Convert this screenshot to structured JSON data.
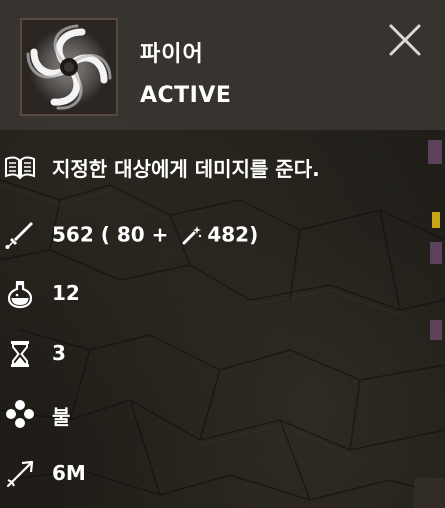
{
  "skill": {
    "name": "파이어",
    "type": "ACTIVE"
  },
  "stats": {
    "description": "지정한 대상에게 데미지를 준다.",
    "damage_total": "562",
    "damage_open": " ( 80 + ",
    "damage_magic": "482)",
    "mana_cost": "12",
    "cooldown": "3",
    "element": "불",
    "range": "6M"
  },
  "icons": {
    "close": "close-icon",
    "description": "book-icon",
    "damage": "sword-icon",
    "magic_power": "wand-icon",
    "mana": "potion-icon",
    "cooldown": "hourglass-icon",
    "element": "element-icon",
    "range": "range-arrow-icon"
  },
  "colors": {
    "header_bg": "#3a3732",
    "text": "#ffffff",
    "icon_frame": "#5a4a3c"
  }
}
